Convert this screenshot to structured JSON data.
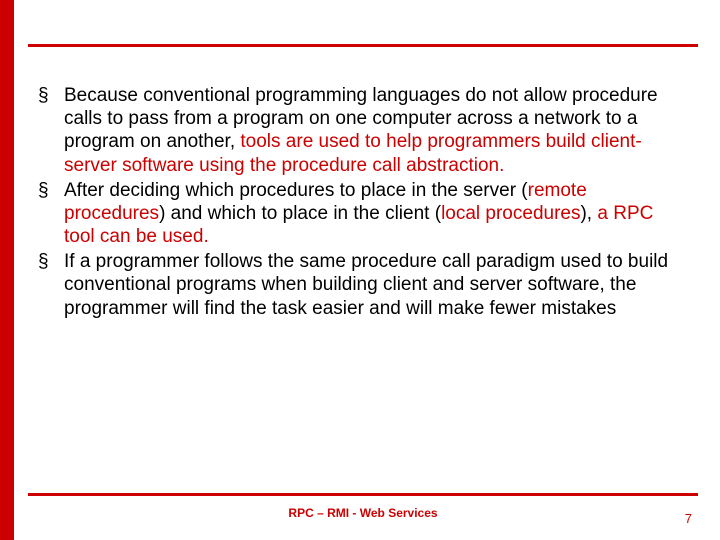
{
  "bullets": [
    {
      "parts": [
        {
          "t": "Because conventional programming languages do not allow procedure calls to pass from a program on one computer across a network to a program on another, ",
          "red": false
        },
        {
          "t": "tools are used to help programmers build client-server software using the procedure call abstraction.",
          "red": true
        }
      ]
    },
    {
      "parts": [
        {
          "t": "After deciding which procedures to place in the server (",
          "red": false
        },
        {
          "t": "remote procedures",
          "red": true
        },
        {
          "t": ") and which to place in the client (",
          "red": false
        },
        {
          "t": "local procedures",
          "red": true
        },
        {
          "t": "), ",
          "red": false
        },
        {
          "t": "a RPC tool can be used.",
          "red": true
        }
      ]
    },
    {
      "parts": [
        {
          "t": "If a programmer follows the same procedure call paradigm used to build conventional programs when building client and server software, the programmer will find the task easier and will make fewer mistakes",
          "red": false
        }
      ]
    }
  ],
  "footer": {
    "title": "RPC – RMI - Web Services",
    "page": "7"
  }
}
